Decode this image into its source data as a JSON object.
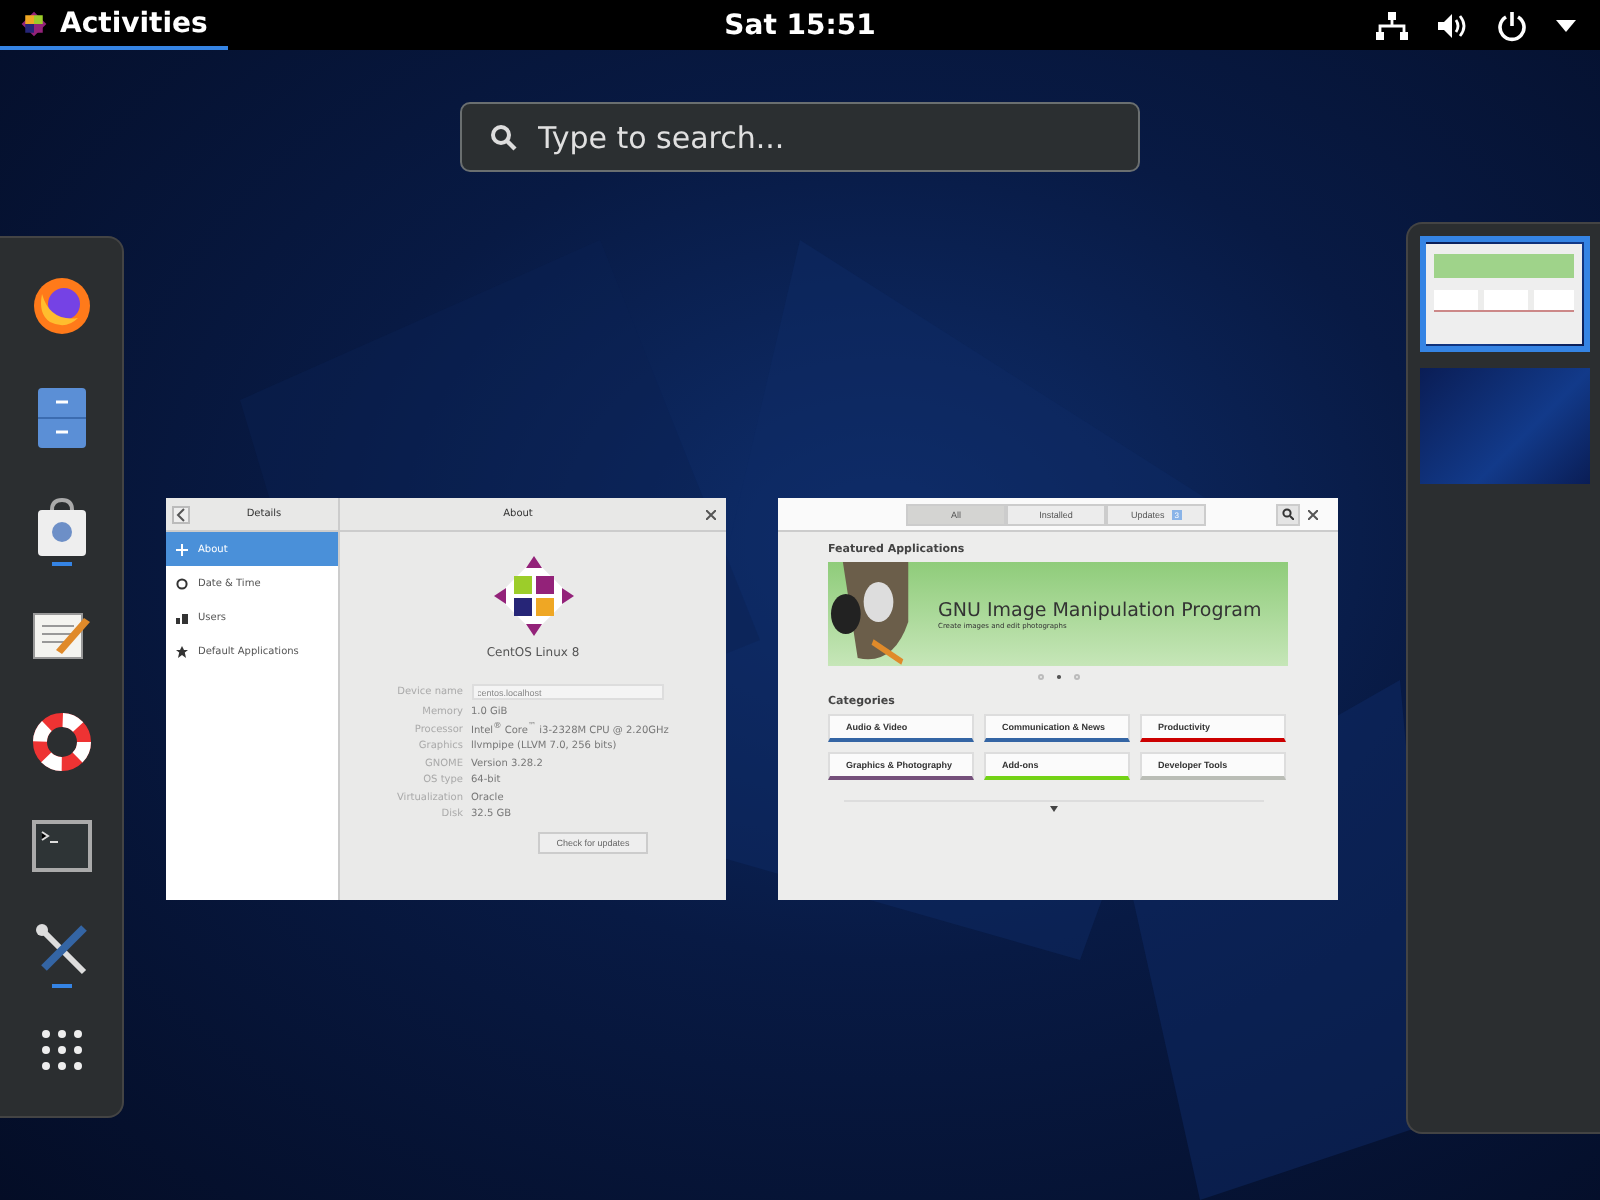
{
  "top_bar": {
    "activities": "Activities",
    "clock": "Sat 15:51"
  },
  "search": {
    "placeholder": "Type to search..."
  },
  "dock": [
    {
      "kind": "firefox",
      "running": false
    },
    {
      "kind": "files",
      "running": false
    },
    {
      "kind": "software",
      "running": true
    },
    {
      "kind": "editor",
      "running": false
    },
    {
      "kind": "help",
      "running": false
    },
    {
      "kind": "terminal",
      "running": false
    },
    {
      "kind": "tools",
      "running": true
    },
    {
      "kind": "grid",
      "running": false
    }
  ],
  "settings_window": {
    "header_left": "Details",
    "header_title": "About",
    "sidebar": [
      {
        "kind": "about",
        "label": "About",
        "selected": true
      },
      {
        "kind": "clock",
        "label": "Date & Time",
        "selected": false
      },
      {
        "kind": "users",
        "label": "Users",
        "selected": false
      },
      {
        "kind": "star",
        "label": "Default Applications",
        "selected": false
      }
    ],
    "os_name": "CentOS Linux 8",
    "device_label": "Device name",
    "device_value": "centos.localhost",
    "details": [
      {
        "label": "Memory",
        "value": "1.0 GiB"
      },
      {
        "label": "Processor",
        "value": "Intel$^{®}$ Core$^{™}$ i3-2328M CPU @ 2.20GHz"
      },
      {
        "label": "Graphics",
        "value": "llvmpipe (LLVM 7.0, 256 bits)"
      },
      {
        "label": "GNOME",
        "value": "Version 3.28.2"
      },
      {
        "label": "OS type",
        "value": "64-bit"
      },
      {
        "label": "Virtualization",
        "value": "Oracle"
      },
      {
        "label": "Disk",
        "value": "32.5 GB"
      }
    ],
    "button": "Check for updates"
  },
  "software_window": {
    "tabs": [
      {
        "label": "All",
        "selected": true
      },
      {
        "label": "Installed",
        "selected": false
      },
      {
        "label": "Updates",
        "selected": false,
        "badge": "3"
      }
    ],
    "featured_title": "Featured Applications",
    "banner": {
      "title": "GNU Image Manipulation Program",
      "subtitle": "Create images and edit photographs"
    },
    "dots": [
      {
        "selected": false
      },
      {
        "selected": true
      },
      {
        "selected": false
      }
    ],
    "categories_title": "Categories",
    "categories": [
      {
        "label": "Audio & Video",
        "color": "#3465a4"
      },
      {
        "label": "Communication & News",
        "color": "#3465a4"
      },
      {
        "label": "Productivity",
        "color": "#cc0000"
      },
      {
        "label": "Graphics & Photography",
        "color": "#75507b"
      },
      {
        "label": "Add-ons",
        "color": "#73d216"
      },
      {
        "label": "Developer Tools",
        "color": "#babdb6"
      }
    ]
  },
  "workspaces": [
    {
      "selected": true,
      "has_window": true
    },
    {
      "selected": false,
      "has_window": false
    }
  ]
}
